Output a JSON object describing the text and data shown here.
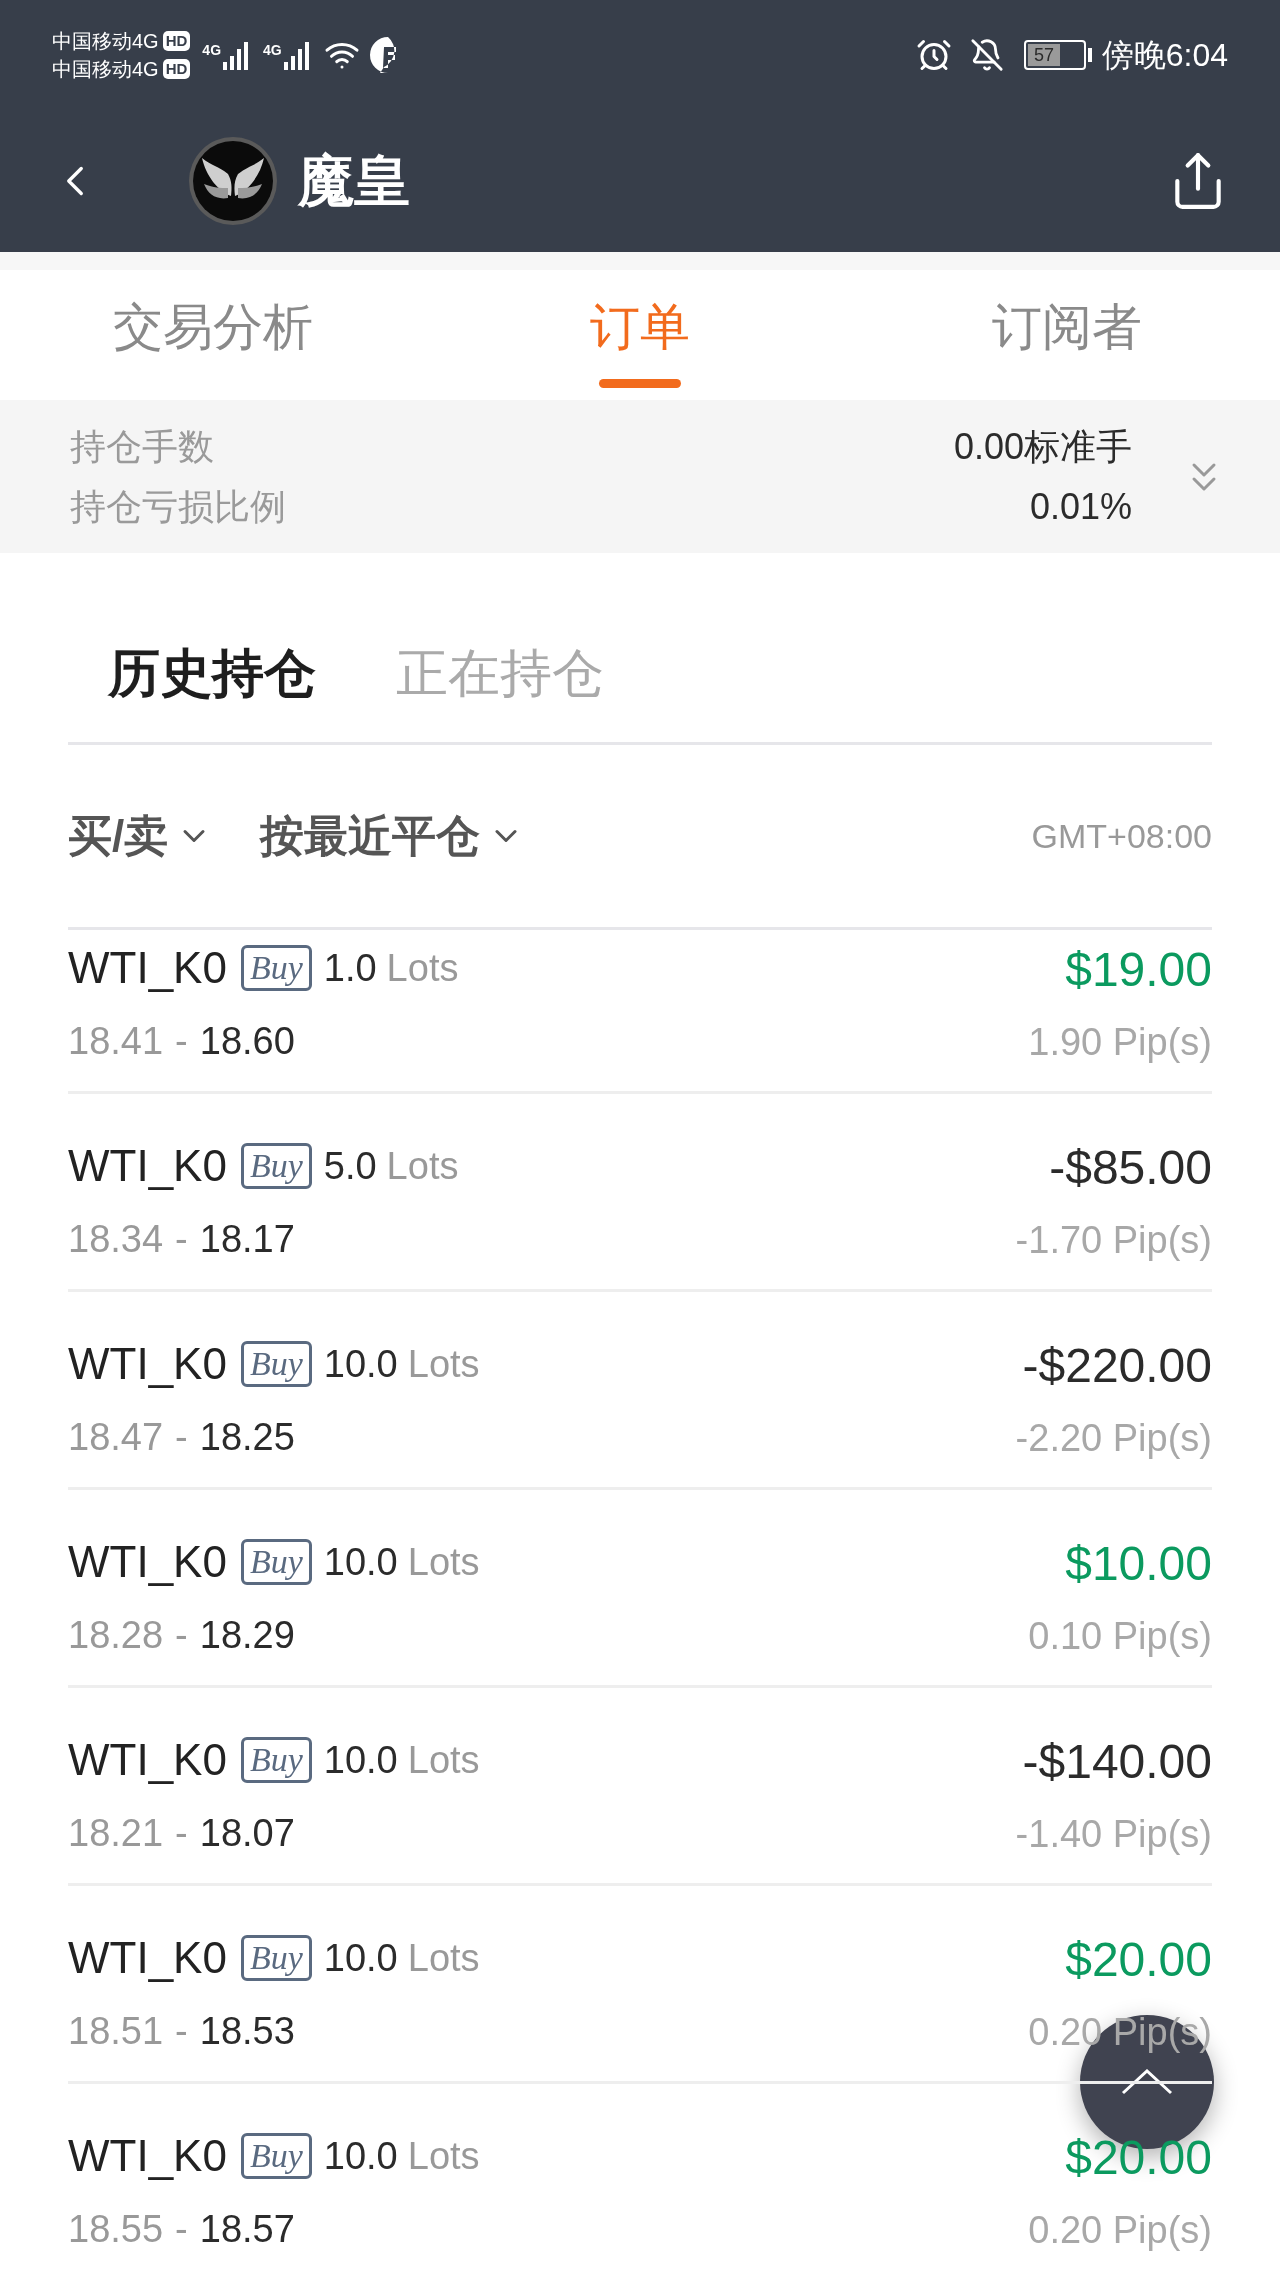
{
  "status_bar": {
    "carriers": [
      {
        "name": "中国移动4G",
        "badge": "HD"
      },
      {
        "name": "中国移动4G",
        "badge": "HD"
      }
    ],
    "networks": [
      "4G",
      "4G"
    ],
    "battery": "57",
    "time": "傍晚6:04"
  },
  "header": {
    "title": "魔皇"
  },
  "tabs": [
    {
      "label": "交易分析",
      "selected": false
    },
    {
      "label": "订单",
      "selected": true
    },
    {
      "label": "订阅者",
      "selected": false
    }
  ],
  "summary": [
    {
      "label": "持仓手数",
      "value": "0.00标准手"
    },
    {
      "label": "持仓亏损比例",
      "value": "0.01%"
    }
  ],
  "subtabs": [
    {
      "label": "历史持仓",
      "selected": true
    },
    {
      "label": "正在持仓",
      "selected": false
    }
  ],
  "filters": [
    "买/卖",
    "按最近平仓"
  ],
  "timezone": "GMT+08:00",
  "orders": [
    {
      "symbol": "WTI_K0",
      "side": "Buy",
      "lots": "1.0",
      "unit": "Lots",
      "open": "18.41",
      "separator": "-",
      "close": "18.60",
      "profit": "$19.00",
      "pips": "1.90 Pip(s)",
      "kind": "gain"
    },
    {
      "symbol": "WTI_K0",
      "side": "Buy",
      "lots": "5.0",
      "unit": "Lots",
      "open": "18.34",
      "separator": "-",
      "close": "18.17",
      "profit": "-$85.00",
      "pips": "-1.70 Pip(s)",
      "kind": "loss"
    },
    {
      "symbol": "WTI_K0",
      "side": "Buy",
      "lots": "10.0",
      "unit": "Lots",
      "open": "18.47",
      "separator": "-",
      "close": "18.25",
      "profit": "-$220.00",
      "pips": "-2.20 Pip(s)",
      "kind": "loss"
    },
    {
      "symbol": "WTI_K0",
      "side": "Buy",
      "lots": "10.0",
      "unit": "Lots",
      "open": "18.28",
      "separator": "-",
      "close": "18.29",
      "profit": "$10.00",
      "pips": "0.10 Pip(s)",
      "kind": "gain"
    },
    {
      "symbol": "WTI_K0",
      "side": "Buy",
      "lots": "10.0",
      "unit": "Lots",
      "open": "18.21",
      "separator": "-",
      "close": "18.07",
      "profit": "-$140.00",
      "pips": "-1.40 Pip(s)",
      "kind": "loss"
    },
    {
      "symbol": "WTI_K0",
      "side": "Buy",
      "lots": "10.0",
      "unit": "Lots",
      "open": "18.51",
      "separator": "-",
      "close": "18.53",
      "profit": "$20.00",
      "pips": "0.20 Pip(s)",
      "kind": "gain"
    },
    {
      "symbol": "WTI_K0",
      "side": "Buy",
      "lots": "10.0",
      "unit": "Lots",
      "open": "18.55",
      "separator": "-",
      "close": "18.57",
      "profit": "$20.00",
      "pips": "0.20 Pip(s)",
      "kind": "gain"
    }
  ]
}
